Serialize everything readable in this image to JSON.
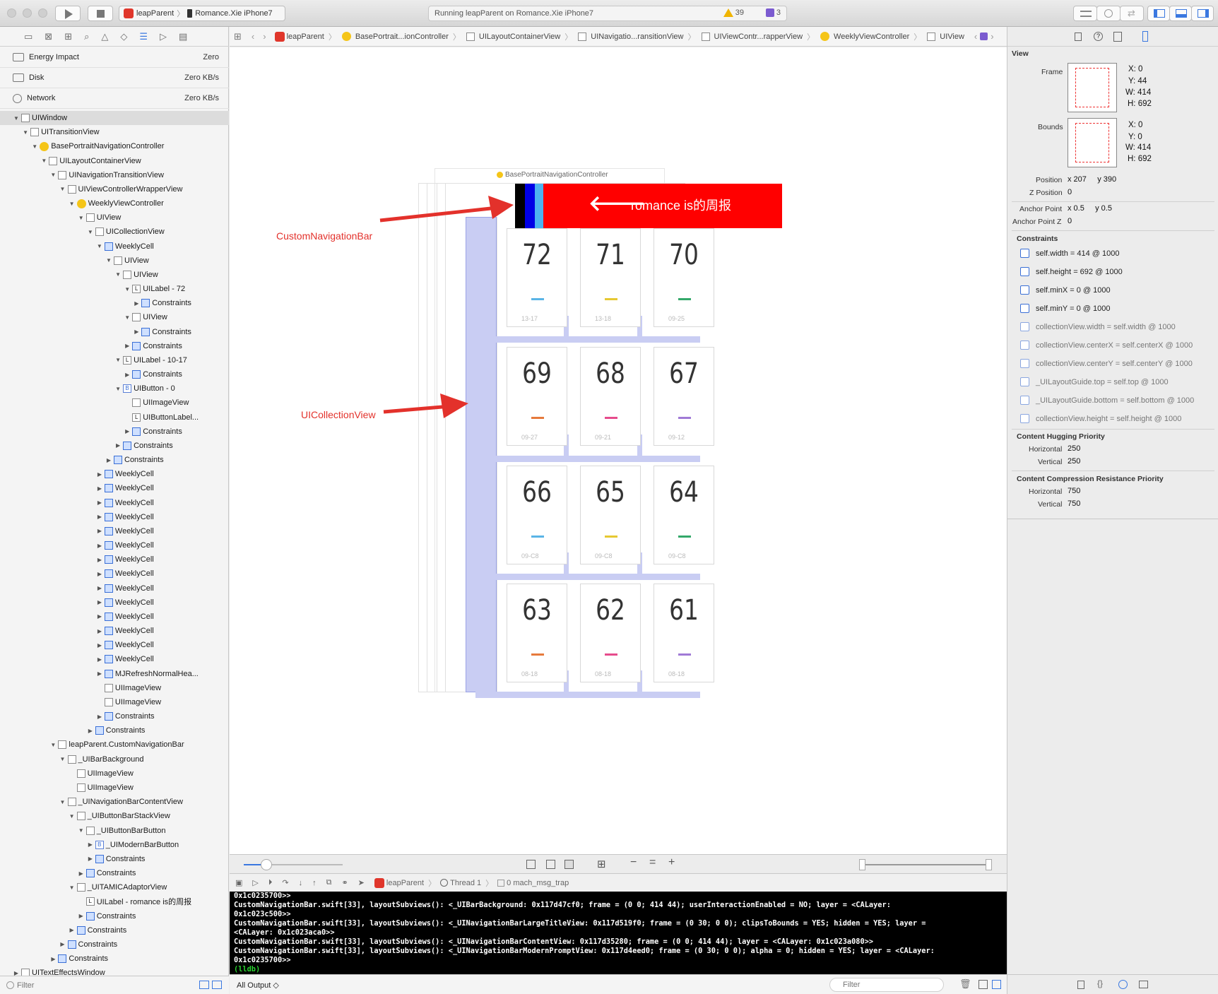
{
  "toolbar": {
    "scheme_app": "leapParent",
    "scheme_device": "Romance.Xie iPhone7",
    "status_text": "Running leapParent on Romance.Xie iPhone7",
    "warnings": "39",
    "issues": "3"
  },
  "gauges": [
    {
      "label": "Energy Impact",
      "value": "Zero"
    },
    {
      "label": "Disk",
      "value": "Zero KB/s"
    },
    {
      "label": "Network",
      "value": "Zero KB/s"
    }
  ],
  "tree": [
    {
      "label": "UIWindow",
      "indent": 0,
      "icon": "view",
      "open": true,
      "sel": true
    },
    {
      "label": "UITransitionView",
      "indent": 1,
      "icon": "view",
      "open": true
    },
    {
      "label": "BasePortraitNavigationController",
      "indent": 2,
      "icon": "vc",
      "open": true
    },
    {
      "label": "UILayoutContainerView",
      "indent": 3,
      "icon": "view",
      "open": true
    },
    {
      "label": "UINavigationTransitionView",
      "indent": 4,
      "icon": "view",
      "open": true
    },
    {
      "label": "UIViewControllerWrapperView",
      "indent": 5,
      "icon": "view",
      "open": true
    },
    {
      "label": "WeeklyViewController",
      "indent": 6,
      "icon": "vc",
      "open": true
    },
    {
      "label": "UIView",
      "indent": 7,
      "icon": "view",
      "open": true
    },
    {
      "label": "UICollectionView",
      "indent": 8,
      "icon": "view",
      "open": true
    },
    {
      "label": "WeeklyCell",
      "indent": 9,
      "icon": "grid",
      "open": true
    },
    {
      "label": "UIView",
      "indent": 10,
      "icon": "view",
      "open": true
    },
    {
      "label": "UIView",
      "indent": 11,
      "icon": "view",
      "open": true
    },
    {
      "label": "UILabel - 72",
      "indent": 12,
      "icon": "label",
      "open": true
    },
    {
      "label": "Constraints",
      "indent": 13,
      "icon": "cons",
      "open": false
    },
    {
      "label": "UIView",
      "indent": 12,
      "icon": "view",
      "open": true
    },
    {
      "label": "Constraints",
      "indent": 13,
      "icon": "cons",
      "open": false
    },
    {
      "label": "Constraints",
      "indent": 12,
      "icon": "cons",
      "open": false
    },
    {
      "label": "UILabel - 10-17",
      "indent": 11,
      "icon": "label",
      "open": true
    },
    {
      "label": "Constraints",
      "indent": 12,
      "icon": "cons",
      "open": false
    },
    {
      "label": "UIButton -  0",
      "indent": 11,
      "icon": "button",
      "open": true
    },
    {
      "label": "UIImageView",
      "indent": 12,
      "icon": "view",
      "open": null
    },
    {
      "label": "UIButtonLabel...",
      "indent": 12,
      "icon": "label",
      "open": null
    },
    {
      "label": "Constraints",
      "indent": 12,
      "icon": "cons",
      "open": false
    },
    {
      "label": "Constraints",
      "indent": 11,
      "icon": "cons",
      "open": false
    },
    {
      "label": "Constraints",
      "indent": 10,
      "icon": "cons",
      "open": false
    },
    {
      "label": "WeeklyCell",
      "indent": 9,
      "icon": "grid",
      "open": false
    },
    {
      "label": "WeeklyCell",
      "indent": 9,
      "icon": "grid",
      "open": false
    },
    {
      "label": "WeeklyCell",
      "indent": 9,
      "icon": "grid",
      "open": false
    },
    {
      "label": "WeeklyCell",
      "indent": 9,
      "icon": "grid",
      "open": false
    },
    {
      "label": "WeeklyCell",
      "indent": 9,
      "icon": "grid",
      "open": false
    },
    {
      "label": "WeeklyCell",
      "indent": 9,
      "icon": "grid",
      "open": false
    },
    {
      "label": "WeeklyCell",
      "indent": 9,
      "icon": "grid",
      "open": false
    },
    {
      "label": "WeeklyCell",
      "indent": 9,
      "icon": "grid",
      "open": false
    },
    {
      "label": "WeeklyCell",
      "indent": 9,
      "icon": "grid",
      "open": false
    },
    {
      "label": "WeeklyCell",
      "indent": 9,
      "icon": "grid",
      "open": false
    },
    {
      "label": "WeeklyCell",
      "indent": 9,
      "icon": "grid",
      "open": false
    },
    {
      "label": "WeeklyCell",
      "indent": 9,
      "icon": "grid",
      "open": false
    },
    {
      "label": "WeeklyCell",
      "indent": 9,
      "icon": "grid",
      "open": false
    },
    {
      "label": "WeeklyCell",
      "indent": 9,
      "icon": "grid",
      "open": false
    },
    {
      "label": "MJRefreshNormalHea...",
      "indent": 9,
      "icon": "grid",
      "open": false
    },
    {
      "label": "UIImageView",
      "indent": 9,
      "icon": "view",
      "open": null
    },
    {
      "label": "UIImageView",
      "indent": 9,
      "icon": "view",
      "open": null
    },
    {
      "label": "Constraints",
      "indent": 9,
      "icon": "cons",
      "open": false
    },
    {
      "label": "Constraints",
      "indent": 8,
      "icon": "cons",
      "open": false
    },
    {
      "label": "leapParent.CustomNavigationBar",
      "indent": 4,
      "icon": "view",
      "open": true
    },
    {
      "label": "_UIBarBackground",
      "indent": 5,
      "icon": "view",
      "open": true
    },
    {
      "label": "UIImageView",
      "indent": 6,
      "icon": "view",
      "open": null
    },
    {
      "label": "UIImageView",
      "indent": 6,
      "icon": "view",
      "open": null
    },
    {
      "label": "_UINavigationBarContentView",
      "indent": 5,
      "icon": "view",
      "open": true
    },
    {
      "label": "_UIButtonBarStackView",
      "indent": 6,
      "icon": "view",
      "open": true
    },
    {
      "label": "_UIButtonBarButton",
      "indent": 7,
      "icon": "view",
      "open": true
    },
    {
      "label": "_UIModernBarButton",
      "indent": 8,
      "icon": "button",
      "open": false
    },
    {
      "label": "Constraints",
      "indent": 8,
      "icon": "cons",
      "open": false
    },
    {
      "label": "Constraints",
      "indent": 7,
      "icon": "cons",
      "open": false
    },
    {
      "label": "_UITAMICAdaptorView",
      "indent": 6,
      "icon": "view",
      "open": true
    },
    {
      "label": "UILabel - romance is的周报",
      "indent": 7,
      "icon": "label",
      "open": null
    },
    {
      "label": "Constraints",
      "indent": 7,
      "icon": "cons",
      "open": false
    },
    {
      "label": "Constraints",
      "indent": 6,
      "icon": "cons",
      "open": false
    },
    {
      "label": "Constraints",
      "indent": 5,
      "icon": "cons",
      "open": false
    },
    {
      "label": "Constraints",
      "indent": 4,
      "icon": "cons",
      "open": false
    },
    {
      "label": "UITextEffectsWindow",
      "indent": 0,
      "icon": "view",
      "open": false
    }
  ],
  "filter_placeholder": "Filter",
  "jumpbar": [
    "leapParent",
    "BasePortrait...ionController",
    "UILayoutContainerView",
    "UINavigatio...ransitionView",
    "UIViewContr...rapperView",
    "WeeklyViewController",
    "UIView"
  ],
  "canvas": {
    "nav_controller_label": "BasePortraitNavigationController",
    "nav_title": "romance is的周报",
    "annotation_navbar": "CustomNavigationBar",
    "annotation_collection": "UICollectionView",
    "cells": [
      {
        "num": "72",
        "color": "#5ab4e6",
        "sub": "13-17"
      },
      {
        "num": "71",
        "color": "#e6c832",
        "sub": "13-18"
      },
      {
        "num": "70",
        "color": "#34a86a",
        "sub": "09-25"
      },
      {
        "num": "69",
        "color": "#e67a3c",
        "sub": "09-27"
      },
      {
        "num": "68",
        "color": "#e64c8c",
        "sub": "09-21"
      },
      {
        "num": "67",
        "color": "#a07ad6",
        "sub": "09-12"
      },
      {
        "num": "66",
        "color": "#5ab4e6",
        "sub": "09-C8"
      },
      {
        "num": "65",
        "color": "#e6c832",
        "sub": "09-C8"
      },
      {
        "num": "64",
        "color": "#34a86a",
        "sub": "09-C8"
      },
      {
        "num": "63",
        "color": "#e67a3c",
        "sub": "08-18"
      },
      {
        "num": "62",
        "color": "#e64c8c",
        "sub": "08-18"
      },
      {
        "num": "61",
        "color": "#a07ad6",
        "sub": "08-18"
      }
    ]
  },
  "debug": {
    "process": "leapParent",
    "thread": "Thread 1",
    "frame": "0 mach_msg_trap",
    "output_selector": "All Output ◇",
    "console_lines": [
      "0x1c0235700>>",
      "CustomNavigationBar.swift[33], layoutSubviews(): <_UIBarBackground: 0x117d47cf0; frame = (0 0; 414 44); userInteractionEnabled = NO; layer = <CALayer:",
      "0x1c023c500>>",
      "CustomNavigationBar.swift[33], layoutSubviews(): <_UINavigationBarLargeTitleView: 0x117d519f0; frame = (0 30; 0 0); clipsToBounds = YES; hidden = YES; layer =",
      "<CALayer: 0x1c023aca0>>",
      "CustomNavigationBar.swift[33], layoutSubviews(): <_UINavigationBarContentView: 0x117d35280; frame = (0 0; 414 44); layer = <CALayer: 0x1c023a080>>",
      "CustomNavigationBar.swift[33], layoutSubviews(): <_UINavigationBarModernPromptView: 0x117d4eed0; frame = (0 30; 0 0); alpha = 0; hidden = YES; layer = <CALayer:",
      "0x1c0235700>>"
    ],
    "prompt": "(lldb)"
  },
  "inspector": {
    "section": "View",
    "frame_label": "Frame",
    "frame": {
      "x": "X: 0",
      "y": "Y: 44",
      "w": "W: 414",
      "h": "H: 692"
    },
    "bounds_label": "Bounds",
    "bounds": {
      "x": "X: 0",
      "y": "Y: 0",
      "w": "W: 414",
      "h": "H: 692"
    },
    "position_label": "Position",
    "position_value": "x 207     y 390",
    "zposition_label": "Z Position",
    "zposition_value": "0",
    "anchor_label": "Anchor Point",
    "anchor_value": "x 0.5     y 0.5",
    "anchorz_label": "Anchor Point Z",
    "anchorz_value": "0",
    "constraints_label": "Constraints",
    "constraints": [
      {
        "text": "self.width = 414 @ 1000",
        "dim": false
      },
      {
        "text": "self.height = 692 @ 1000",
        "dim": false
      },
      {
        "text": "self.minX = 0 @ 1000",
        "dim": false
      },
      {
        "text": "self.minY = 0 @ 1000",
        "dim": false
      },
      {
        "text": "collectionView.width = self.width @ 1000",
        "dim": true
      },
      {
        "text": "collectionView.centerX = self.centerX @ 1000",
        "dim": true
      },
      {
        "text": "collectionView.centerY = self.centerY @ 1000",
        "dim": true
      },
      {
        "text": "_UILayoutGuide.top = self.top @ 1000",
        "dim": true
      },
      {
        "text": "_UILayoutGuide.bottom = self.bottom @ 1000",
        "dim": true
      },
      {
        "text": "collectionView.height = self.height @ 1000",
        "dim": true
      }
    ],
    "hugging_label": "Content Hugging Priority",
    "hugging_h_label": "Horizontal",
    "hugging_h": "250",
    "hugging_v_label": "Vertical",
    "hugging_v": "250",
    "compression_label": "Content Compression Resistance Priority",
    "compression_h_label": "Horizontal",
    "compression_h": "750",
    "compression_v_label": "Vertical",
    "compression_v": "750"
  }
}
